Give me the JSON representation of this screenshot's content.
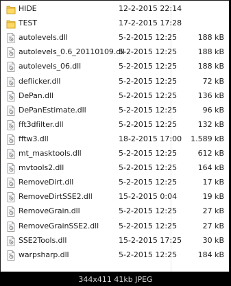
{
  "files": [
    {
      "name": "HIDE",
      "date": "12-2-2015 22:14",
      "size": "",
      "icon": "folder-icon"
    },
    {
      "name": "TEST",
      "date": "17-2-2015 17:28",
      "size": "",
      "icon": "folder-icon"
    },
    {
      "name": "autolevels.dll",
      "date": "5-2-2015 12:25",
      "size": "188 kB",
      "icon": "dll-file-icon"
    },
    {
      "name": "autolevels_0.6_20110109.dll",
      "date": "5-2-2015 12:25",
      "size": "188 kB",
      "icon": "dll-file-icon"
    },
    {
      "name": "autolevels_06.dll",
      "date": "5-2-2015 12:25",
      "size": "188 kB",
      "icon": "dll-file-icon"
    },
    {
      "name": "deflicker.dll",
      "date": "5-2-2015 12:25",
      "size": "72 kB",
      "icon": "dll-file-icon"
    },
    {
      "name": "DePan.dll",
      "date": "5-2-2015 12:25",
      "size": "136 kB",
      "icon": "dll-file-icon"
    },
    {
      "name": "DePanEstimate.dll",
      "date": "5-2-2015 12:25",
      "size": "96 kB",
      "icon": "dll-file-icon"
    },
    {
      "name": "fft3dfilter.dll",
      "date": "5-2-2015 12:25",
      "size": "132 kB",
      "icon": "dll-file-icon"
    },
    {
      "name": "fftw3.dll",
      "date": "18-2-2015 17:00",
      "size": "1.589 kB",
      "icon": "dll-file-icon"
    },
    {
      "name": "mt_masktools.dll",
      "date": "5-2-2015 12:25",
      "size": "612 kB",
      "icon": "dll-file-icon"
    },
    {
      "name": "mvtools2.dll",
      "date": "5-2-2015 12:25",
      "size": "164 kB",
      "icon": "dll-file-icon"
    },
    {
      "name": "RemoveDirt.dll",
      "date": "5-2-2015 12:25",
      "size": "17 kB",
      "icon": "dll-file-icon"
    },
    {
      "name": "RemoveDirtSSE2.dll",
      "date": "15-2-2015 0:04",
      "size": "19 kB",
      "icon": "dll-file-icon"
    },
    {
      "name": "RemoveGrain.dll",
      "date": "5-2-2015 12:25",
      "size": "27 kB",
      "icon": "dll-file-icon"
    },
    {
      "name": "RemoveGrainSSE2.dll",
      "date": "5-2-2015 12:25",
      "size": "27 kB",
      "icon": "dll-file-icon"
    },
    {
      "name": "SSE2Tools.dll",
      "date": "15-2-2015 17:25",
      "size": "30 kB",
      "icon": "dll-file-icon"
    },
    {
      "name": "warpsharp.dll",
      "date": "5-2-2015 12:25",
      "size": "184 kB",
      "icon": "dll-file-icon"
    }
  ],
  "caption": "344x411 41kb JPEG"
}
